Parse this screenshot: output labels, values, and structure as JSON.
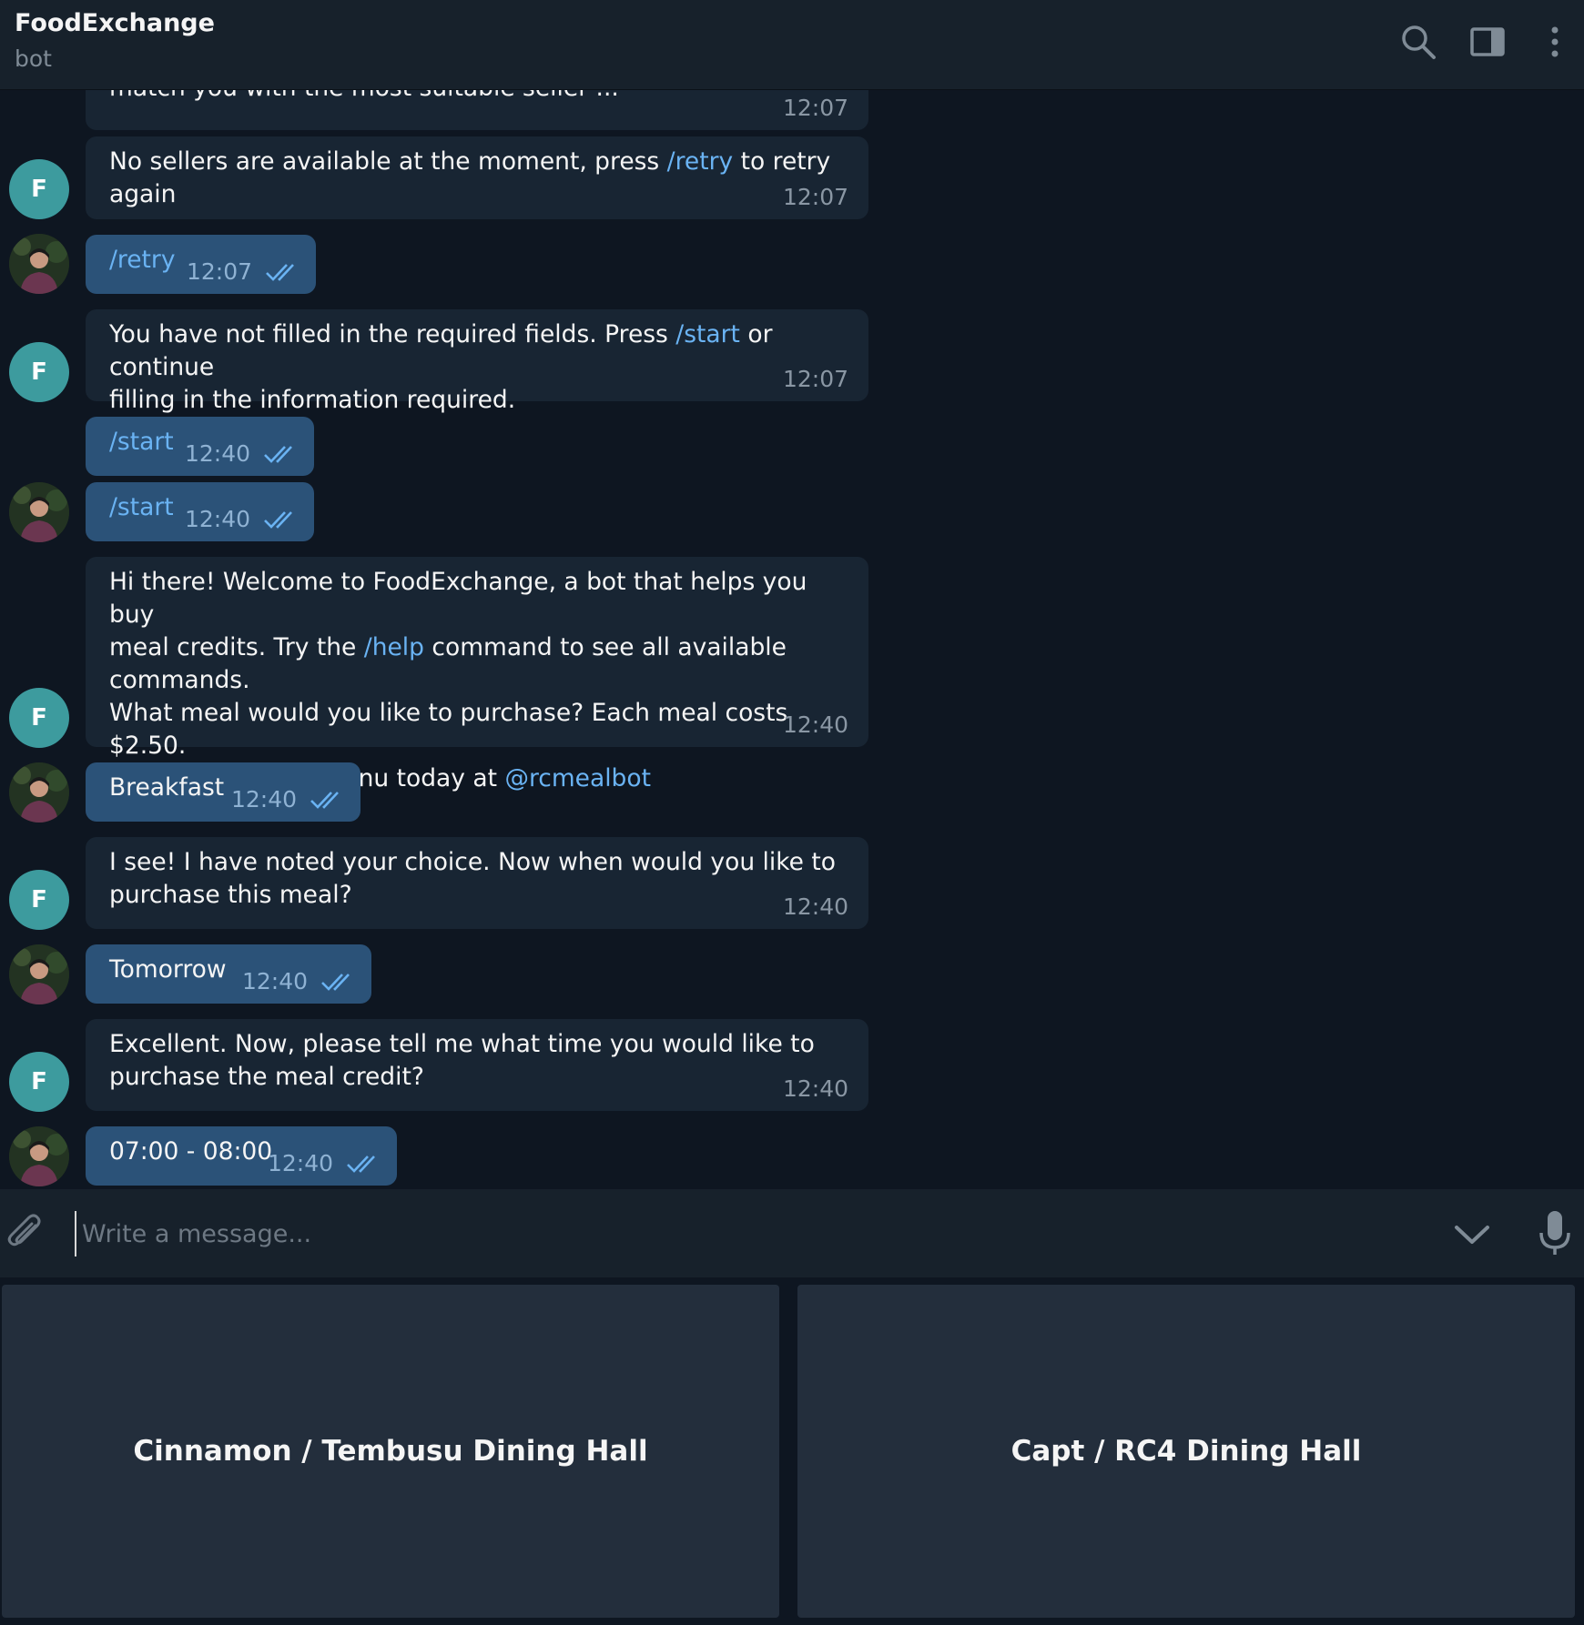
{
  "header": {
    "title": "FoodExchange",
    "status": "bot"
  },
  "messages": [
    {
      "id": "m0",
      "dir": "in",
      "line1": "match you with the most suitable seller ...",
      "time": "12:07"
    },
    {
      "id": "m1",
      "dir": "in",
      "pre": "No sellers are available at the moment, press ",
      "link": "/retry",
      "post": " to retry again",
      "time": "12:07"
    },
    {
      "id": "m2",
      "dir": "out",
      "link": "/retry",
      "time": "12:07"
    },
    {
      "id": "m3",
      "dir": "in",
      "pre": "You have not filled in the required fields. Press ",
      "link": "/start",
      "post": " or continue\nfilling in the information required.",
      "time": "12:07"
    },
    {
      "id": "m4",
      "dir": "out",
      "link": "/start",
      "time": "12:40"
    },
    {
      "id": "m5",
      "dir": "out",
      "link": "/start",
      "time": "12:40"
    },
    {
      "id": "m6",
      "dir": "in",
      "pre": "Hi there! Welcome to FoodExchange, a bot that helps you buy\nmeal credits. Try the ",
      "link": "/help",
      "mid": " command to see all available\ncommands.\nWhat meal would you like to purchase? Each meal costs $2.50.\nYou can view the menu today at ",
      "link2": "@rcmealbot",
      "time": "12:40"
    },
    {
      "id": "m7",
      "dir": "out",
      "text": "Breakfast",
      "time": "12:40"
    },
    {
      "id": "m8",
      "dir": "in",
      "text": "I see! I have noted your choice. Now when would you like to\npurchase this meal?",
      "time": "12:40"
    },
    {
      "id": "m9",
      "dir": "out",
      "text": "Tomorrow",
      "time": "12:40"
    },
    {
      "id": "m10",
      "dir": "in",
      "text": "Excellent. Now, please tell me what time you would like to\npurchase the meal credit?",
      "time": "12:40"
    },
    {
      "id": "m11",
      "dir": "out",
      "text": "07:00 - 08:00",
      "time": "12:40"
    }
  ],
  "avatar_bot_letter": "F",
  "composer": {
    "placeholder": "Write a message..."
  },
  "keyboard": {
    "buttons": [
      "Cinnamon / Tembusu Dining Hall",
      "Capt / RC4 Dining Hall"
    ]
  },
  "icons": [
    "search-icon",
    "sidebar-toggle-icon",
    "more-vertical-icon",
    "attach-icon",
    "chevron-down-icon",
    "microphone-icon",
    "double-check-icon"
  ],
  "colors": {
    "background": "#0e1621",
    "incoming": "#182533",
    "outgoing": "#2b5278",
    "link": "#6ab3f3",
    "avatar": "#3d9b9e"
  }
}
